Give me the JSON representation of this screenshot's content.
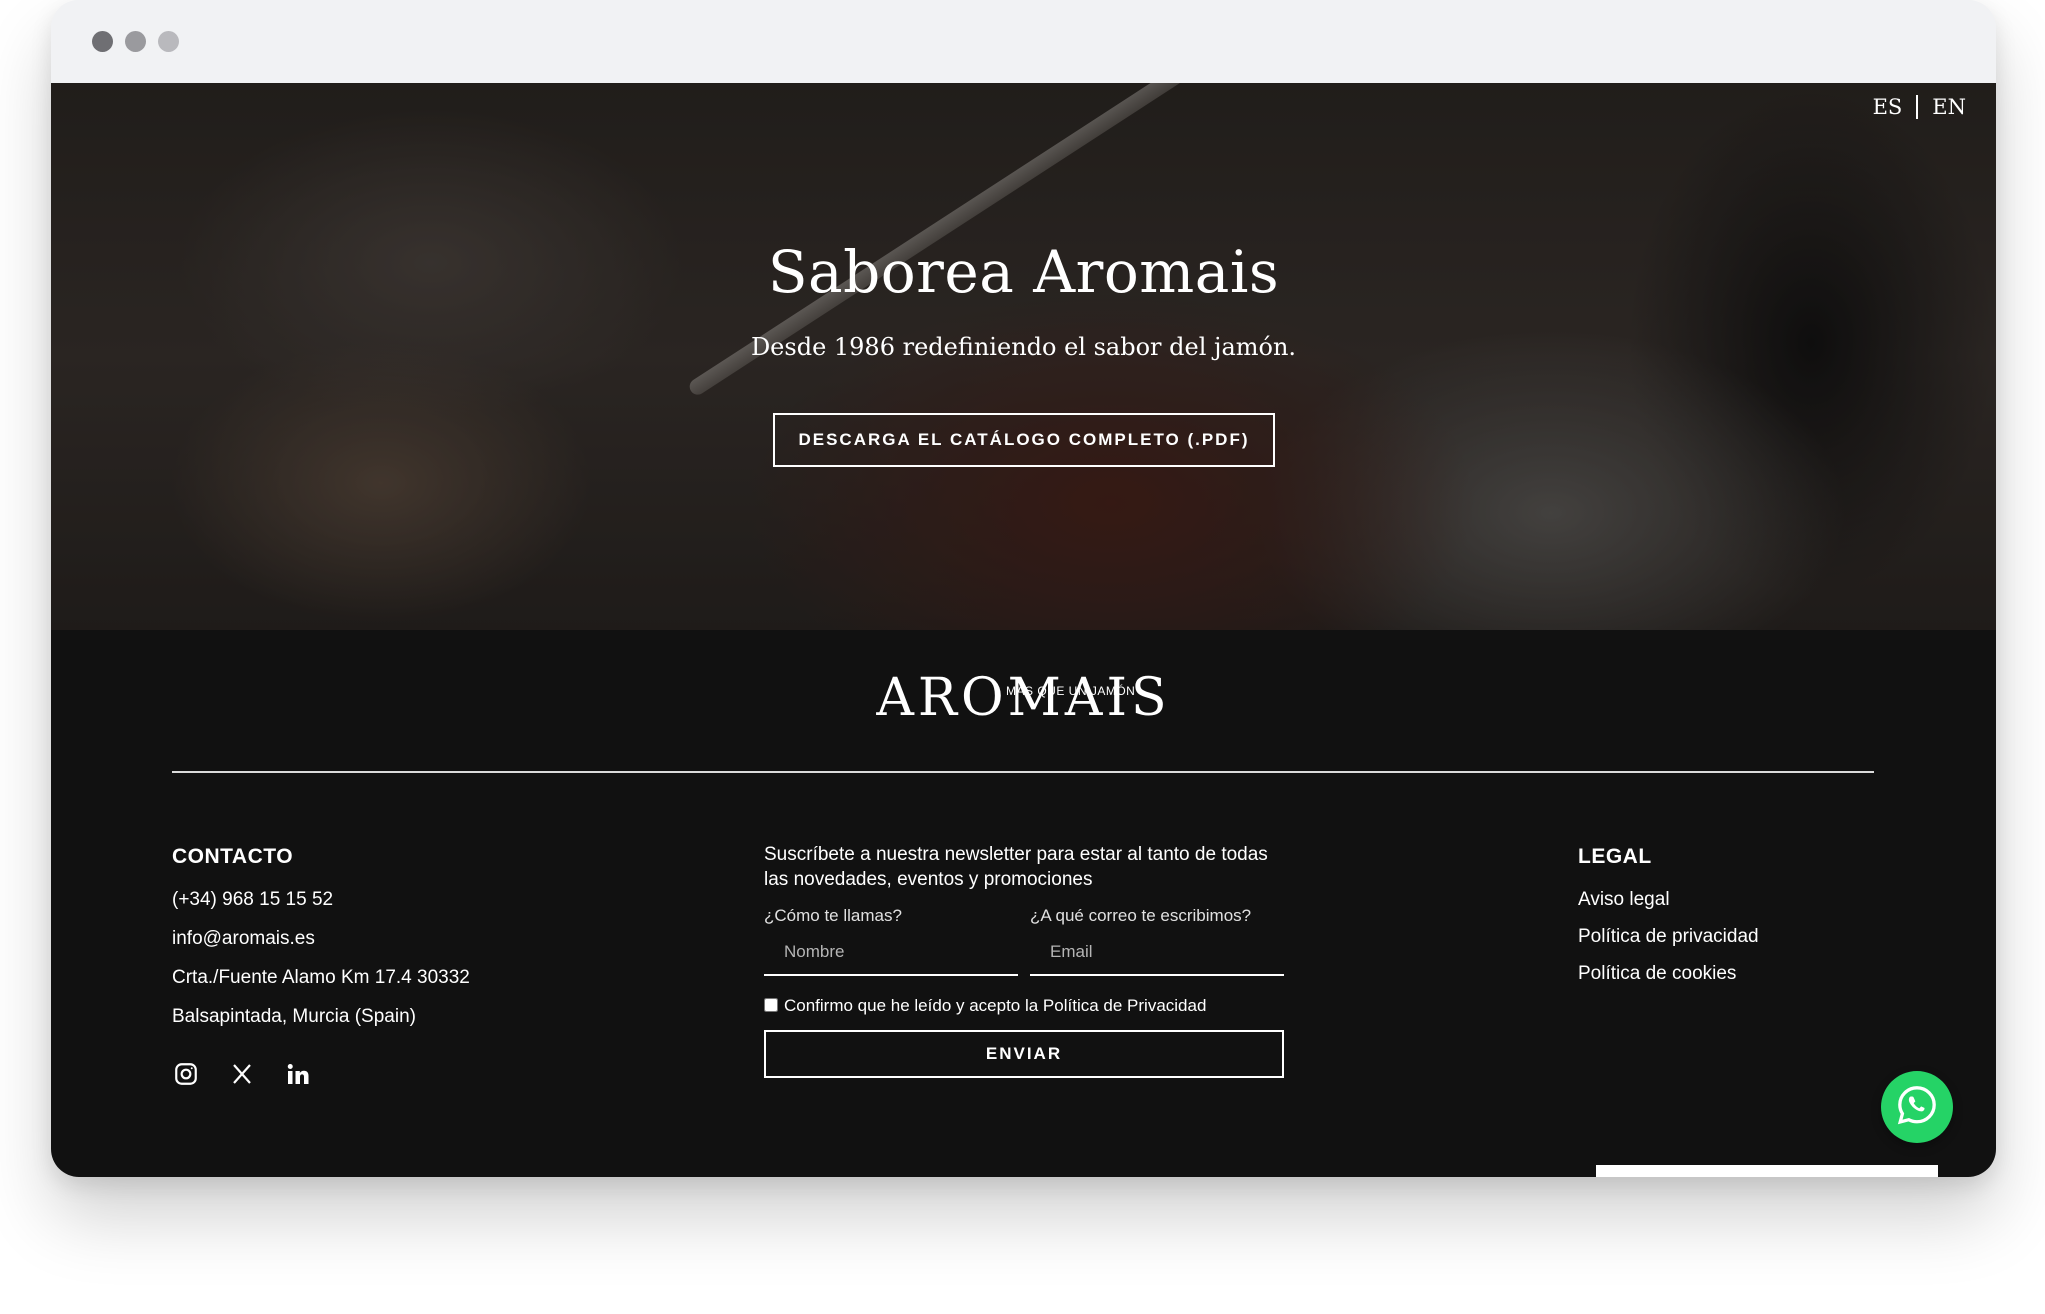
{
  "hero": {
    "lang_es": "ES",
    "lang_en": "EN",
    "title": "Saborea Aromais",
    "subtitle": "Desde 1986 redefiniendo el sabor del jamón.",
    "catalog_button": "DESCARGA EL CATÁLOGO COMPLETO (.PDF)"
  },
  "footer": {
    "logo_text": "AROMAIS",
    "logo_tagline": "MÁS QUE UN JAMÓN",
    "contact": {
      "heading": "CONTACTO",
      "phone": "(+34) 968 15 15 52",
      "email": "info@aromais.es",
      "address_line1": "Crta./Fuente Alamo Km 17.4 30332",
      "address_line2": "Balsapintada, Murcia (Spain)"
    },
    "socials": [
      "instagram-icon",
      "x-icon",
      "linkedin-icon"
    ],
    "newsletter": {
      "intro": "Suscríbete a nuestra newsletter para estar al tanto de todas las novedades, eventos y promociones",
      "name_label": "¿Cómo te llamas?",
      "name_placeholder": "Nombre",
      "email_label": "¿A qué correo te escribimos?",
      "email_placeholder": "Email",
      "consent": "Confirmo que he leído y acepto la Política de Privacidad",
      "submit": "ENVIAR"
    },
    "legal": {
      "heading": "LEGAL",
      "links": [
        "Aviso legal",
        "Política de privacidad",
        "Política de cookies"
      ]
    }
  },
  "colors": {
    "footer_bg": "#111111",
    "whatsapp": "#25d366",
    "text": "#ffffff"
  }
}
